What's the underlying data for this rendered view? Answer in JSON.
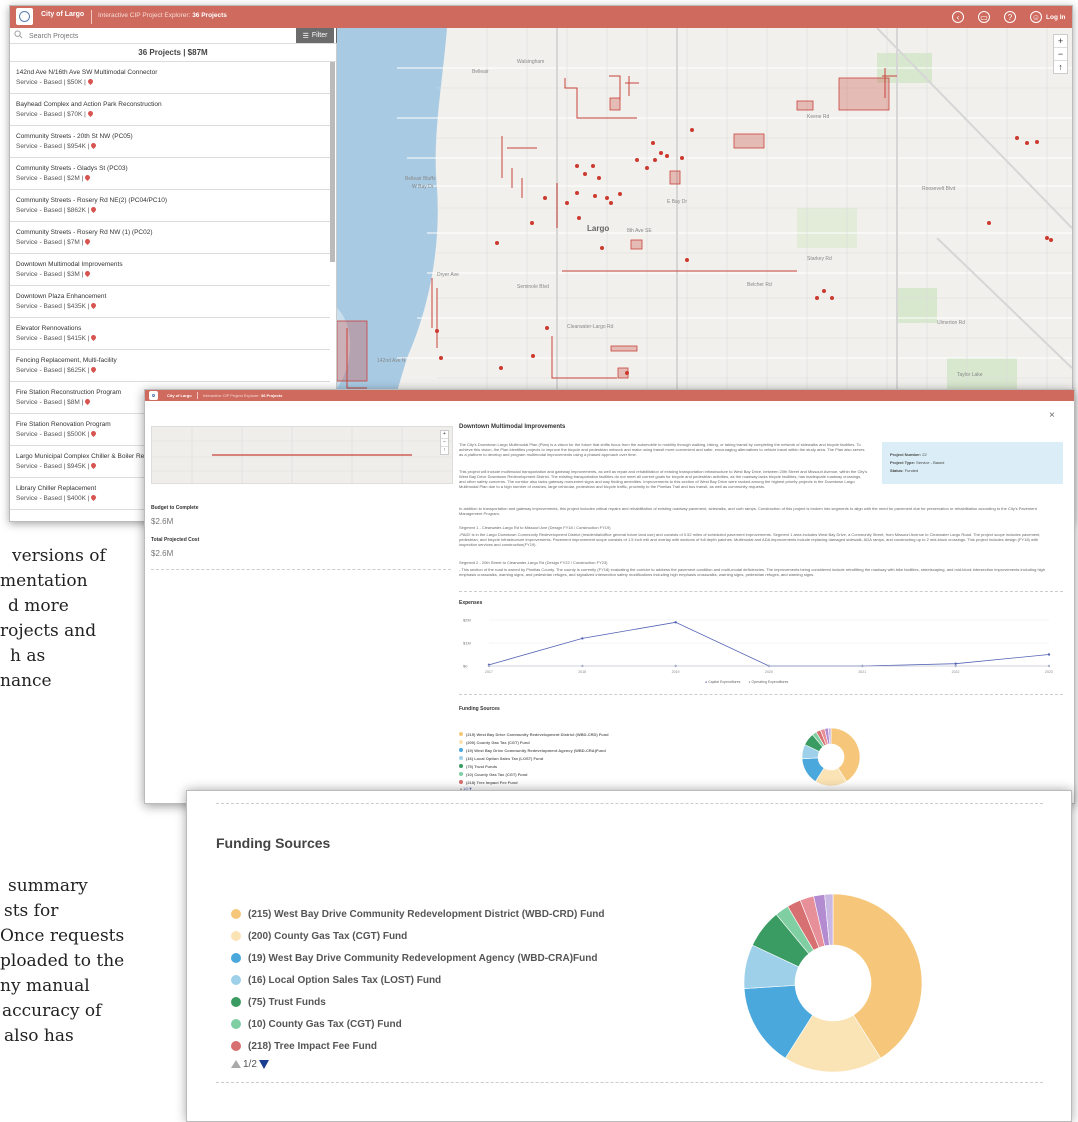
{
  "background_text": {
    "block1": [
      "versions of",
      "mentation",
      "d more",
      "rojects and",
      "h as",
      "nance"
    ],
    "block2": [
      "summary",
      "sts for",
      "Once requests",
      "ploaded to the",
      "ny manual",
      "accuracy of",
      "also has"
    ]
  },
  "app": {
    "city": "City of Largo",
    "title": "Interactive CIP Project Explorer:",
    "count": "36 Projects",
    "login_label": "Log In",
    "brand_color": "#cf6a5e"
  },
  "sidebar": {
    "search_placeholder": "Search Projects",
    "filter_label": "Filter",
    "collapse_label": "<<",
    "summary": "36 Projects   |   $87M",
    "projects": [
      {
        "name": "142nd Ave N/16th Ave SW Multimodal Connector",
        "meta": "Service - Based | $50K |"
      },
      {
        "name": "Bayhead Complex and Action Park Reconstruction",
        "meta": "Service - Based | $70K |"
      },
      {
        "name": "Community Streets - 20th St NW (PC05)",
        "meta": "Service - Based | $954K |"
      },
      {
        "name": "Community Streets - Gladys St (PC03)",
        "meta": "Service - Based | $2M |"
      },
      {
        "name": "Community Streets - Rosery Rd NE(2) (PC04/PC10)",
        "meta": "Service - Based | $862K |"
      },
      {
        "name": "Community Streets - Rosery Rd NW (1) (PC02)",
        "meta": "Service - Based | $7M |"
      },
      {
        "name": "Downtown Multimodal Improvements",
        "meta": "Service - Based | $3M |"
      },
      {
        "name": "Downtown Plaza Enhancement",
        "meta": "Service - Based | $435K |"
      },
      {
        "name": "Elevator Rennovations",
        "meta": "Service - Based | $415K |"
      },
      {
        "name": "Fencing Replacement, Multi-facility",
        "meta": "Service - Based | $625K |"
      },
      {
        "name": "Fire Station Reconstruction Program",
        "meta": "Service - Based | $8M |"
      },
      {
        "name": "Fire Station Renovation Program",
        "meta": "Service - Based | $500K |"
      },
      {
        "name": "Largo Municipal Complex Chiller & Boiler Replacement",
        "meta": "Service - Based | $945K |"
      },
      {
        "name": "Library Chiller Replacement",
        "meta": "Service - Based | $400K |"
      }
    ]
  },
  "map": {
    "labels": [
      "Belleair",
      "Belleair Bluffs",
      "Largo",
      "W Bay Dr",
      "E Bay Dr",
      "Roosevelt Blvd",
      "Ulmerton Rd",
      "8th Ave SE",
      "Dryer Ave",
      "142nd Ave N",
      "Starkey Rd",
      "Seminole Blvd",
      "Clearwater-Largo Rd",
      "Belcher Rd",
      "Taylor Lake",
      "Keene Rd",
      "Walsingham"
    ],
    "zoom_in": "+",
    "zoom_out": "−",
    "compass": "↑"
  },
  "detail": {
    "title": "Downtown Multimodal Improvements",
    "close": "×",
    "budget_label": "Budget to Complete",
    "budget_value": "$2.6M",
    "total_label": "Total Projected Cost",
    "total_value": "$2.6M",
    "project_number_label": "Project Number:",
    "project_number": "22",
    "project_type_label": "Project Type:",
    "project_type": "Service - Based",
    "status_label": "Status:",
    "status": "Funded",
    "paragraphs": [
      "The City's Downtown Largo Multimodal Plan (Plan) is a vision for the future that shifts focus from the automobile to mobility through walking, biking, or taking transit by completing the network of sidewalks and bicycle facilities. To achieve this vision, the Plan identifies projects to improve the bicycle and pedestrian network and make using transit more convenient and safer, encouraging alternatives to vehicle travel within the study area. The Plan also serves as a platform to develop and program multimodal improvements using a phased approach over time.",
      "This project will include multimodal transportation and gateway improvements, as well as repair and rehabilitation of existing transportation infrastructure to West Bay Drive, between 20th Street and Missouri Avenue, within the City's West Bay Drive Downtown Redevelopment District. The existing transportation facilities do not meet all current goals for bicycle and pedestrian activities, as the roadway lacks bicycle facilities, has inadequate roadway crossings, and other safety concerns. The corridor also lacks gateway monument signs and way finding amenities. Improvements to this section of West Bay Drive were ranked among the highest priority projects in the Downtown Largo Multimodal Plan due to a high number of crashes, large vehicular, pedestrian and bicycle traffic, proximity to the Pinellas Trail and bus transit, as well as community requests.",
      "In addition to transportation and gateway improvements, this project includes critical repairs and rehabilitation of existing roadway pavement, sidewalks, and curb ramps. Construction of this project is broken into segments to align with the need for pavement due for preservation or rehabilitation according to the City's Pavement Management Program.",
      "Segment 1 - Clearwater-Largo Rd to Missouri Ave (Design FY18 / Construction FY19)",
      "-PAID! is in the Largo Downtown Community Redevelopment District (residential/office general future land use) and consists of 0.52 miles of scheduled pavement improvements. Segment 1 area includes West Bay Drive, a Community Street, from Missouri Avenue to Clearwater Largo Road. The project scope includes pavement, pedestrian, and bicycle infrastructure improvements. Pavement improvement scope consists of 1.5 inch mill and overlay with sections of full depth patches. Multimodal and ADA improvements include replacing damaged sidewalk, ADA ramps, and constructing up to 2 mid-block crossings. This project includes design (FY18) with inspection services and construction(FY19).",
      "Segment 2 - 20th Street to Clearwater-Largo Rd (Design FY22 / Construction FY23)",
      "- This section of the road is owned by Pinellas County. The county is currently (FY18) evaluating the corridor to address the pavement condition and multi-modal deficiencies. The improvements being considered include retrofitting the roadway with bike facilities, streetscaping, and mid-block intersection improvements including high emphasis crosswalks, warning signs, and pedestrian refuges, and signalized intersection safety modifications including high emphasis crosswalks, warning signs, pedestrian refuges, and warning signs."
    ],
    "expenses_label": "Expenses",
    "funding_label": "Funding Sources",
    "expense_chart_legend": [
      "Capital Expenditures",
      "Operating Expenditures"
    ]
  },
  "chart_data": [
    {
      "type": "line",
      "title": "Expenses",
      "x": [
        "2017",
        "2018",
        "2019",
        "2020",
        "2021",
        "2022",
        "2023"
      ],
      "series": [
        {
          "name": "Capital Expenditures",
          "values": [
            0.05,
            1.2,
            1.9,
            0.0,
            0.0,
            0.1,
            0.5
          ]
        },
        {
          "name": "Operating Expenditures",
          "values": [
            0,
            0,
            0,
            0,
            0,
            0,
            0
          ]
        }
      ],
      "y_ticks": [
        "$2M",
        "$1M",
        "$0"
      ],
      "ylim": [
        0,
        2
      ]
    },
    {
      "type": "pie",
      "title": "Funding Sources",
      "labels": [
        "(215) West Bay Drive Community Redevelopment District (WBD-CRD) Fund",
        "(200) County Gas Tax (CGT) Fund",
        "(19) West Bay Drive Community Redevelopment Agency (WBD-CRA)Fund",
        "(16) Local Option Sales Tax (LOST) Fund",
        "(75) Trust Funds",
        "(10) County Gas Tax (CGT) Fund",
        "(218) Tree Impact Fee Fund",
        "",
        "",
        ""
      ],
      "values": [
        41,
        18,
        15,
        8,
        7,
        2.5,
        2.5,
        2.5,
        2,
        1.5
      ],
      "colors": [
        "#f6c77a",
        "#fae3b4",
        "#4aa8dc",
        "#9ed0ea",
        "#3a9c63",
        "#80cfa3",
        "#d77070",
        "#e8909a",
        "#b28bd0",
        "#c9b8e3"
      ],
      "pager": "1/2"
    }
  ]
}
